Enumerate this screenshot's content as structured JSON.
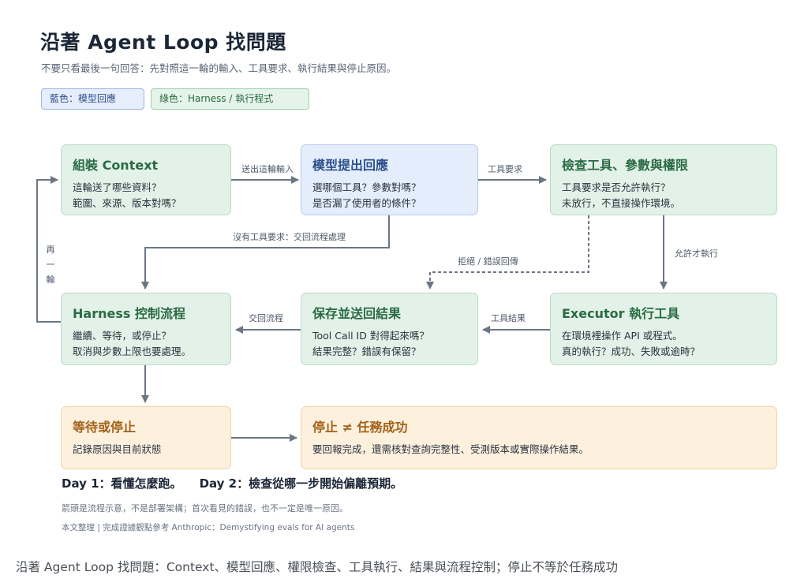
{
  "header": {
    "title": "沿著 Agent Loop 找問題",
    "subtitle": "不要只看最後一句回答：先對照這一輪的輸入、工具要求、執行結果與停止原因。"
  },
  "legend": {
    "blue": "藍色：模型回應",
    "green": "綠色：Harness / 執行程式"
  },
  "boxes": {
    "context": {
      "title": "組裝 Context",
      "lines": [
        "這輪送了哪些資料？",
        "範圍、來源、版本對嗎？"
      ]
    },
    "model": {
      "title": "模型提出回應",
      "lines": [
        "選哪個工具？參數對嗎？",
        "是否漏了使用者的條件？"
      ]
    },
    "check": {
      "title": "檢查工具、參數與權限",
      "lines": [
        "工具要求是否允許執行？",
        "未放行，不直接操作環境。"
      ]
    },
    "harness": {
      "title": "Harness 控制流程",
      "lines": [
        "繼續、等待，或停止？",
        "取消與步數上限也要處理。"
      ]
    },
    "save": {
      "title": "保存並送回結果",
      "lines": [
        "Tool Call ID 對得起來嗎？",
        "結果完整？錯誤有保留？"
      ]
    },
    "executor": {
      "title": "Executor 執行工具",
      "lines": [
        "在環境裡操作 API 或程式。",
        "真的執行？成功、失敗或逾時？"
      ]
    },
    "wait": {
      "title": "等待或停止",
      "lines": [
        "記錄原因與目前狀態"
      ]
    },
    "stop": {
      "title": "停止 ≠ 任務成功",
      "lines": [
        "要回報完成，還需核對查詢完整性、受測版本或實際操作結果。"
      ]
    }
  },
  "edges": {
    "send_round": "送出這輪輸入",
    "tool_request": "工具要求",
    "no_tool": "沒有工具要求：交回流程處理",
    "allowed": "允許才執行",
    "rejected": "拒絕 / 錯誤回傳",
    "tool_result": "工具結果",
    "return_flow": "交回流程",
    "next_round": [
      "再",
      "一",
      "輪"
    ]
  },
  "footer": {
    "day1": "Day 1：看懂怎麼跑。",
    "day2": "Day 2：檢查從哪一步開始偏離預期。",
    "note": "箭頭是流程示意，不是部署架構；首次看見的錯誤，也不一定是唯一原因。",
    "source": "本文整理 | 完成證據觀點參考 Anthropic：Demystifying evals for AI agents"
  },
  "caption": "沿著 Agent Loop 找問題：Context、模型回應、權限檢查、工具執行、結果與流程控制；停止不等於任務成功",
  "colors": {
    "green_fill": "#e3f2e8",
    "blue_fill": "#e4edfb",
    "orange_fill": "#fdf1de",
    "arrow": "#6b7685"
  }
}
